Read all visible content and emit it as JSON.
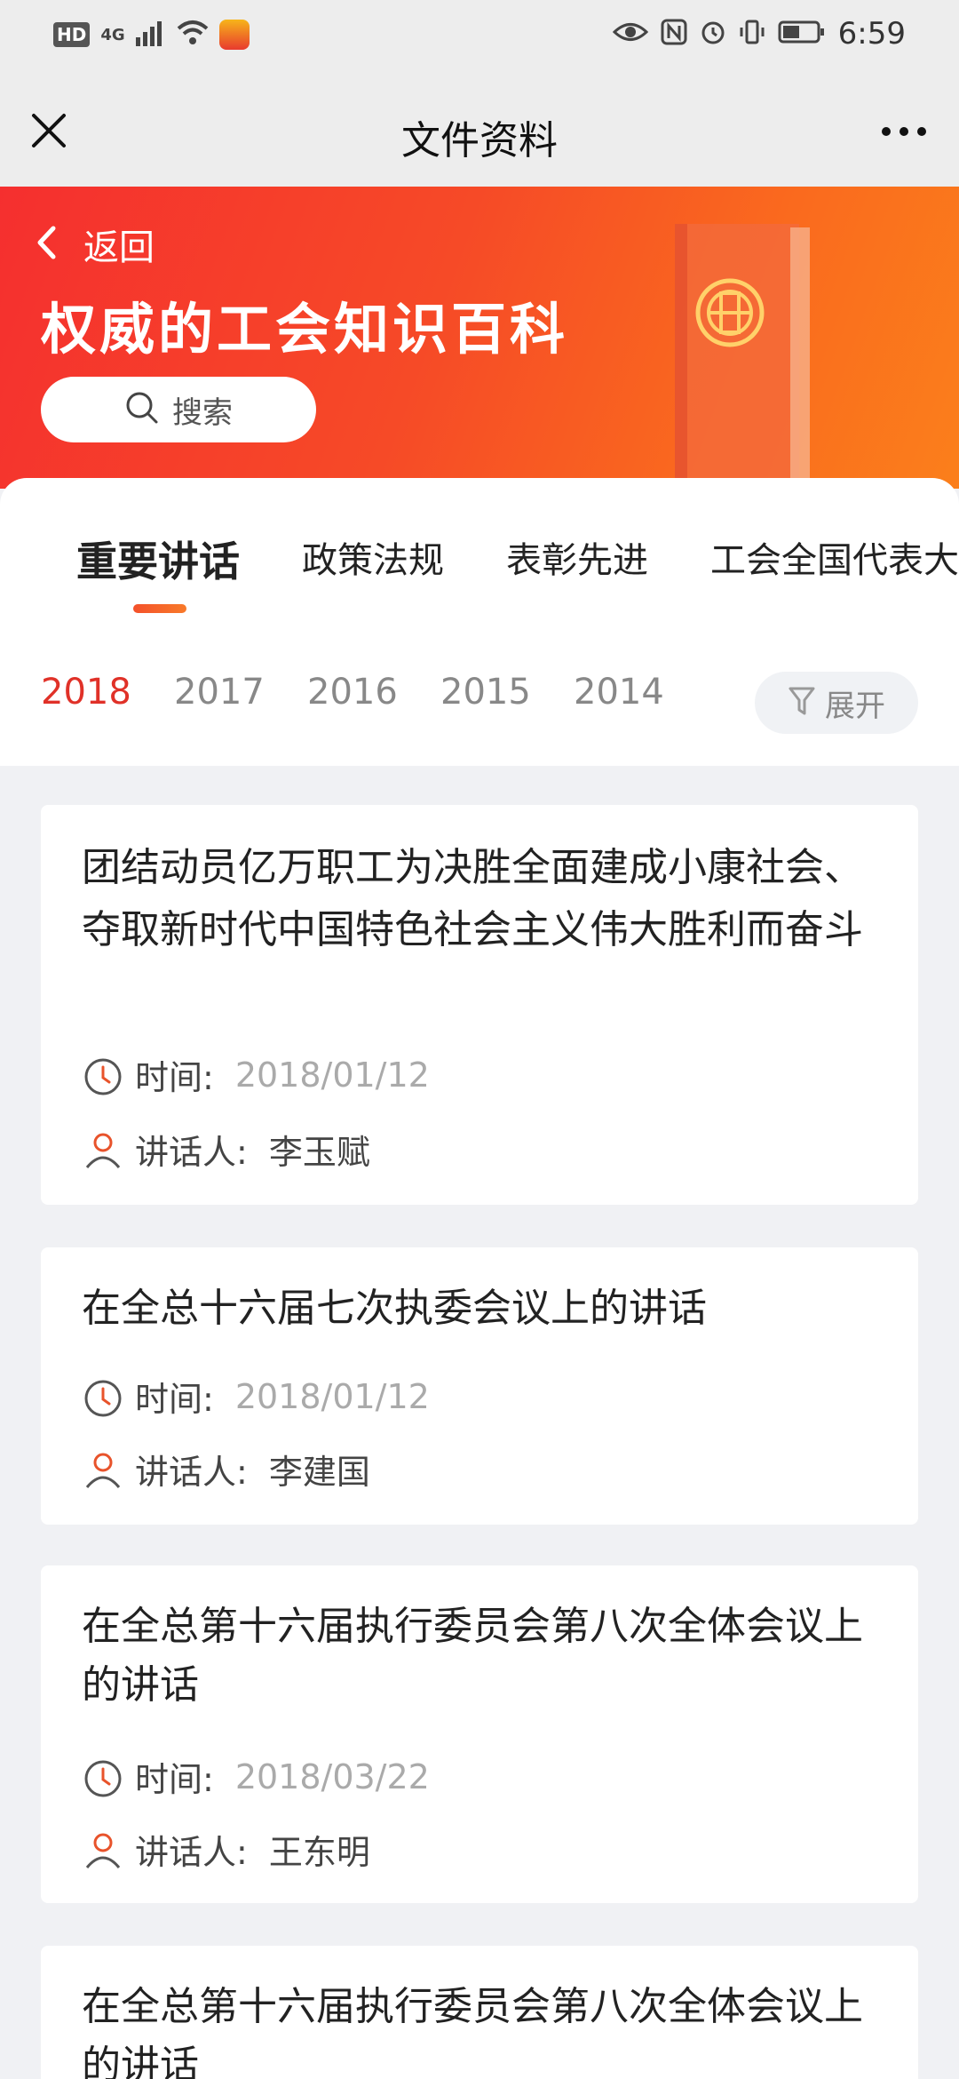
{
  "status_bar": {
    "hd": "HD",
    "signal": "4G",
    "time": "6:59"
  },
  "nav": {
    "title": "文件资料"
  },
  "banner": {
    "back_label": "返回",
    "title": "权威的工会知识百科",
    "search_label": "搜索",
    "colors": {
      "start": "#f52f2f",
      "end": "#fb7f1b"
    }
  },
  "tabs": [
    {
      "label": "重要讲话",
      "active": true
    },
    {
      "label": "政策法规",
      "active": false
    },
    {
      "label": "表彰先进",
      "active": false
    },
    {
      "label": "工会全国代表大",
      "active": false
    }
  ],
  "years": [
    {
      "label": "2018",
      "active": true
    },
    {
      "label": "2017",
      "active": false
    },
    {
      "label": "2016",
      "active": false
    },
    {
      "label": "2015",
      "active": false
    },
    {
      "label": "2014",
      "active": false
    }
  ],
  "expand_label": "展开",
  "meta_labels": {
    "time": "时间:",
    "speaker": "讲话人:"
  },
  "items": [
    {
      "title": "团结动员亿万职工为决胜全面建成小康社会、夺取新时代中国特色社会主义伟大胜利而奋斗",
      "time": "2018/01/12",
      "speaker": "李玉赋"
    },
    {
      "title": "在全总十六届七次执委会议上的讲话",
      "time": "2018/01/12",
      "speaker": "李建国"
    },
    {
      "title": "在全总第十六届执行委员会第八次全体会议上的讲话",
      "time": "2018/03/22",
      "speaker": "王东明"
    },
    {
      "title": "在全总第十六届执行委员会第八次全体会议上的讲话"
    }
  ],
  "accent_color": "#e03128"
}
